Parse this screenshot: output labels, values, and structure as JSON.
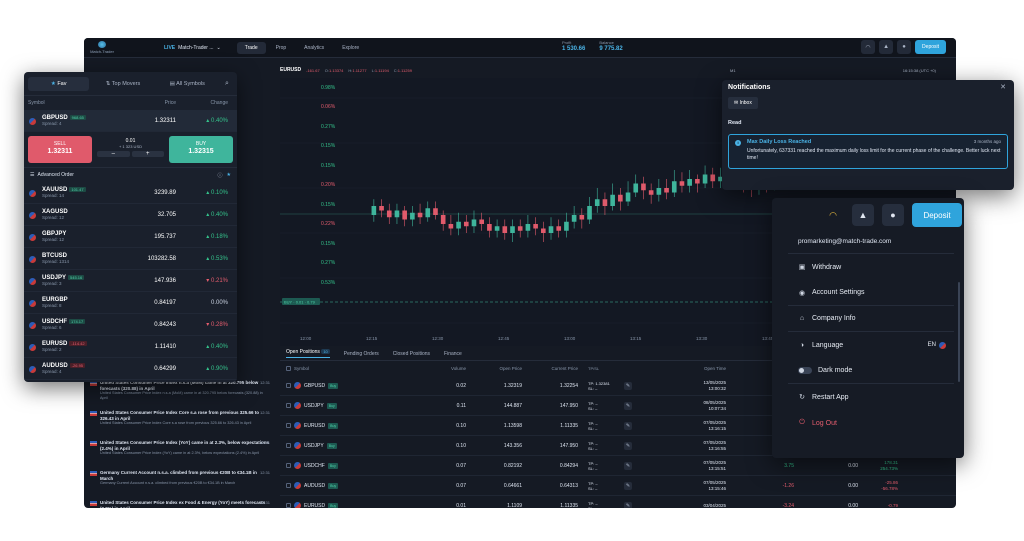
{
  "topbar": {
    "logo_text": "Match-Trader",
    "account_badge": "LIVE",
    "account_name": "Match-Trader ...",
    "tabs": [
      "Trade",
      "Prop",
      "Analytics",
      "Explore"
    ],
    "profit_label": "Profit",
    "profit_value": "1 530.66",
    "balance_label": "Balance",
    "balance_value": "9 775.82",
    "deposit_label": "Deposit"
  },
  "chart_header": {
    "symbol": "EURUSD",
    "change": "-161.67",
    "o_label": "O:",
    "o_value": "1.13374",
    "h_label": "H:",
    "h_value": "1.11277",
    "l_label": "L:",
    "l_value": "1.11194",
    "c_label": "C:",
    "c_value": "1.11259",
    "timeframe": "M1",
    "clock": "16:15:38 (UTC +0)"
  },
  "chart": {
    "x_ticks": [
      "12:00",
      "12:15",
      "12:30",
      "12:45",
      "13:00",
      "13:15",
      "13:30",
      "13:45",
      "14:00"
    ],
    "buy_tag": "BUY · 0.01 · 0.79",
    "reset_zoom": "Reset zoom",
    "candles": [
      [
        0.48,
        0.52,
        0.55,
        0.45
      ],
      [
        0.52,
        0.5,
        0.55,
        0.47
      ],
      [
        0.5,
        0.47,
        0.53,
        0.44
      ],
      [
        0.47,
        0.5,
        0.53,
        0.44
      ],
      [
        0.5,
        0.46,
        0.52,
        0.43
      ],
      [
        0.46,
        0.49,
        0.52,
        0.43
      ],
      [
        0.49,
        0.47,
        0.53,
        0.44
      ],
      [
        0.47,
        0.51,
        0.54,
        0.45
      ],
      [
        0.51,
        0.48,
        0.54,
        0.46
      ],
      [
        0.48,
        0.44,
        0.5,
        0.41
      ],
      [
        0.44,
        0.42,
        0.48,
        0.39
      ],
      [
        0.42,
        0.45,
        0.49,
        0.39
      ],
      [
        0.45,
        0.43,
        0.48,
        0.4
      ],
      [
        0.43,
        0.46,
        0.5,
        0.4
      ],
      [
        0.46,
        0.44,
        0.49,
        0.41
      ],
      [
        0.44,
        0.41,
        0.47,
        0.38
      ],
      [
        0.41,
        0.43,
        0.46,
        0.38
      ],
      [
        0.43,
        0.4,
        0.46,
        0.37
      ],
      [
        0.4,
        0.43,
        0.46,
        0.36
      ],
      [
        0.43,
        0.41,
        0.46,
        0.38
      ],
      [
        0.41,
        0.44,
        0.48,
        0.38
      ],
      [
        0.44,
        0.42,
        0.47,
        0.39
      ],
      [
        0.42,
        0.4,
        0.45,
        0.36
      ],
      [
        0.4,
        0.43,
        0.47,
        0.37
      ],
      [
        0.43,
        0.41,
        0.46,
        0.38
      ],
      [
        0.41,
        0.45,
        0.49,
        0.38
      ],
      [
        0.45,
        0.48,
        0.52,
        0.42
      ],
      [
        0.48,
        0.46,
        0.51,
        0.42
      ],
      [
        0.46,
        0.52,
        0.56,
        0.44
      ],
      [
        0.52,
        0.55,
        0.6,
        0.49
      ],
      [
        0.55,
        0.52,
        0.58,
        0.48
      ],
      [
        0.52,
        0.57,
        0.62,
        0.5
      ],
      [
        0.57,
        0.54,
        0.6,
        0.5
      ],
      [
        0.54,
        0.58,
        0.63,
        0.52
      ],
      [
        0.58,
        0.62,
        0.66,
        0.56
      ],
      [
        0.62,
        0.59,
        0.65,
        0.55
      ],
      [
        0.59,
        0.57,
        0.62,
        0.53
      ],
      [
        0.57,
        0.6,
        0.64,
        0.54
      ],
      [
        0.6,
        0.58,
        0.64,
        0.55
      ],
      [
        0.58,
        0.63,
        0.68,
        0.56
      ],
      [
        0.63,
        0.61,
        0.67,
        0.58
      ],
      [
        0.61,
        0.64,
        0.68,
        0.58
      ],
      [
        0.64,
        0.62,
        0.66,
        0.58
      ],
      [
        0.62,
        0.66,
        0.7,
        0.6
      ],
      [
        0.66,
        0.63,
        0.69,
        0.6
      ],
      [
        0.63,
        0.65,
        0.69,
        0.6
      ],
      [
        0.65,
        0.67,
        0.71,
        0.62
      ],
      [
        0.67,
        0.64,
        0.7,
        0.61
      ],
      [
        0.64,
        0.62,
        0.67,
        0.58
      ],
      [
        0.62,
        0.6,
        0.65,
        0.56
      ],
      [
        0.6,
        0.63,
        0.67,
        0.57
      ],
      [
        0.63,
        0.61,
        0.66,
        0.58
      ],
      [
        0.61,
        0.64,
        0.68,
        0.59
      ],
      [
        0.64,
        0.68,
        0.72,
        0.62
      ],
      [
        0.68,
        0.66,
        0.71,
        0.63
      ],
      [
        0.66,
        0.7,
        0.74,
        0.64
      ],
      [
        0.7,
        0.68,
        0.73,
        0.65
      ],
      [
        0.68,
        0.72,
        0.76,
        0.66
      ],
      [
        0.72,
        0.75,
        0.8,
        0.7
      ],
      [
        0.75,
        0.78,
        0.82,
        0.72
      ],
      [
        0.78,
        0.76,
        0.81,
        0.73
      ],
      [
        0.76,
        0.8,
        0.84,
        0.74
      ],
      [
        0.8,
        0.82,
        0.86,
        0.78
      ],
      [
        0.82,
        0.79,
        0.85,
        0.76
      ],
      [
        0.79,
        0.82,
        0.86,
        0.77
      ],
      [
        0.82,
        0.8,
        0.85,
        0.77
      ],
      [
        0.8,
        0.84,
        0.88,
        0.78
      ],
      [
        0.84,
        0.86,
        0.9,
        0.82
      ],
      [
        0.86,
        0.83,
        0.89,
        0.8
      ],
      [
        0.83,
        0.87,
        0.91,
        0.81
      ],
      [
        0.87,
        0.85,
        0.9,
        0.82
      ],
      [
        0.85,
        0.88,
        0.92,
        0.83
      ],
      [
        0.88,
        0.86,
        0.91,
        0.84
      ],
      [
        0.86,
        0.89,
        0.93,
        0.84
      ]
    ]
  },
  "positions": {
    "tabs": [
      {
        "label": "Open Positions",
        "count": "10"
      },
      {
        "label": "Pending Orders",
        "count": ""
      },
      {
        "label": "Closed Positions",
        "count": ""
      },
      {
        "label": "Finance",
        "count": ""
      }
    ],
    "columns": [
      "Symbol",
      "Volume",
      "Open Price",
      "Current Price",
      "TP/SL",
      "Open Time",
      "Swap",
      "Commission",
      "Net P/L"
    ],
    "rows": [
      {
        "symbol": "GBPUSD",
        "side": "Buy",
        "volume": "0.02",
        "open": "1.32319",
        "current": "1.32254",
        "tp": "TP: 1.32381",
        "sl": "SL: –",
        "date": "13/05/2025",
        "time": "13:00:32",
        "swap": "",
        "comm": "",
        "pnl": "",
        "pnl2": ""
      },
      {
        "symbol": "USDJPY",
        "side": "Buy",
        "volume": "0.11",
        "open": "144.887",
        "current": "147.950",
        "tp": "TP: –",
        "sl": "SL: –",
        "date": "08/05/2025",
        "time": "10:07:34",
        "swap": "",
        "comm": "",
        "pnl": "",
        "pnl2": ""
      },
      {
        "symbol": "EURUSD",
        "side": "Buy",
        "volume": "0.10",
        "open": "1.13598",
        "current": "1.11335",
        "tp": "TP: –",
        "sl": "SL: –",
        "date": "07/05/2025",
        "time": "13:16:15",
        "swap": "",
        "comm": "",
        "pnl": "",
        "pnl2": ""
      },
      {
        "symbol": "USDJPY",
        "side": "Buy",
        "volume": "0.10",
        "open": "143.356",
        "current": "147.950",
        "tp": "TP: –",
        "sl": "SL: –",
        "date": "07/05/2025",
        "time": "13:16:55",
        "swap": "",
        "comm": "",
        "pnl": "",
        "pnl2": ""
      },
      {
        "symbol": "USDCHF",
        "side": "Buy",
        "volume": "0.07",
        "open": "0.82192",
        "current": "0.84294",
        "tp": "TP: –",
        "sl": "SL: –",
        "date": "07/05/2025",
        "time": "13:15:51",
        "swap": "3.75",
        "comm": "0.00",
        "pnl": "178.31",
        "pnl2": "254.73%"
      },
      {
        "symbol": "AUDUSD",
        "side": "Buy",
        "volume": "0.07",
        "open": "0.64661",
        "current": "0.64313",
        "tp": "TP: –",
        "sl": "SL: –",
        "date": "07/05/2025",
        "time": "13:15:46",
        "swap": "-1.26",
        "comm": "0.00",
        "pnl": "-25.86",
        "pnl2": "-56.78%"
      },
      {
        "symbol": "EURUSD",
        "side": "Buy",
        "volume": "0.01",
        "open": "1.1109",
        "current": "1.11335",
        "tp": "TP: –",
        "sl": "SL: –",
        "date": "03/04/2025",
        "time": "",
        "swap": "-3.24",
        "comm": "0.00",
        "pnl": "-0.79",
        "pnl2": ""
      }
    ]
  },
  "bg_changes": [
    "0.98%",
    "0.06%",
    "0.27%",
    "0.15%",
    "0.15%",
    "0.20%",
    "0.15%",
    "0.22%",
    "0.15%",
    "0.27%",
    "0.53%"
  ],
  "news": [
    {
      "title": "United States Consumer Price Index n.s.a (MoM) came in at 320.795 below forecasts (320.88) in April",
      "sub": "United States Consumer Price Index n.s.a (MoM) came in at 320.795 below forecasts (320.88) in April",
      "time": "12:31"
    },
    {
      "title": "United States Consumer Price Index Core s.a rose from previous 325.66 to 326.43 in April",
      "sub": "United States Consumer Price Index Core s.a rose from previous 325.66 to 326.43 in April",
      "time": "12:31"
    },
    {
      "title": "United States Consumer Price Index (YoY) came in at 2.3%, below expectations (2.4%) in April",
      "sub": "United States Consumer Price Index (YoY) came in at 2.3%, below expectations (2.4%) in April",
      "time": "12:31"
    },
    {
      "title": "Germany Current Account n.s.a. climbed from previous €20B to €34.1B in March",
      "sub": "Germany Current Account n.s.a. climbed from previous €20B to €34.1B in March",
      "time": "12:31"
    },
    {
      "title": "United States Consumer Price Index ex Food & Energy (YoY) meets forecasts (2.8%) in April",
      "sub": "",
      "time": "12:31"
    }
  ],
  "watchlist": {
    "tabs": [
      "Fav",
      "Top Movers",
      "All Symbols"
    ],
    "col_symbol": "Symbol",
    "col_price": "Price",
    "col_change": "Change",
    "selected": {
      "symbol": "GBPUSD",
      "badge": "968.65",
      "spread": "Spread: 4",
      "price": "1.32311",
      "change": "0.40%"
    },
    "sell_label": "SELL",
    "sell_price": "1.32311",
    "buy_label": "BUY",
    "buy_price": "1.32315",
    "lot": "0.01",
    "units": "+ 1 323 USD",
    "minus": "–",
    "plus": "+",
    "advanced_order": "Advanced Order",
    "rows": [
      {
        "symbol": "XAUUSD",
        "badge": "101.47",
        "neg": false,
        "spread": "Spread: 14",
        "price": "3239.89",
        "change": "0.10%",
        "up": true
      },
      {
        "symbol": "XAGUSD",
        "badge": "",
        "neg": false,
        "spread": "Spread: 12",
        "price": "32.705",
        "change": "0.40%",
        "up": true
      },
      {
        "symbol": "GBPJPY",
        "badge": "",
        "neg": false,
        "spread": "Spread: 12",
        "price": "195.737",
        "change": "0.18%",
        "up": true
      },
      {
        "symbol": "BTCUSD",
        "badge": "",
        "neg": false,
        "spread": "Spread: 1314",
        "price": "103282.58",
        "change": "0.53%",
        "up": true
      },
      {
        "symbol": "USDJPY",
        "badge": "545.16",
        "neg": false,
        "spread": "Spread: 3",
        "price": "147.936",
        "change": "0.21%",
        "up": false
      },
      {
        "symbol": "EURGBP",
        "badge": "",
        "neg": false,
        "spread": "Spread: 8",
        "price": "0.84197",
        "change": "0.00%",
        "up": null
      },
      {
        "symbol": "USDCHF",
        "badge": "174.17",
        "neg": false,
        "spread": "Spread: 6",
        "price": "0.84243",
        "change": "0.28%",
        "up": false
      },
      {
        "symbol": "EURUSD",
        "badge": "-114.42",
        "neg": true,
        "spread": "Spread: 2",
        "price": "1.11410",
        "change": "0.40%",
        "up": true
      },
      {
        "symbol": "AUDUSD",
        "badge": "-26.95",
        "neg": true,
        "spread": "Spread: 4",
        "price": "0.64299",
        "change": "0.90%",
        "up": true
      }
    ]
  },
  "notifications": {
    "title": "Notifications",
    "tab": "Inbox",
    "section": "Read",
    "card_title": "Max Daily Loss Reached",
    "card_ago": "3 months ago",
    "card_body": "Unfortunately, 637331 reached the maximum daily loss limit for the current phase of the challenge. Better luck next time!"
  },
  "account_menu": {
    "deposit": "Deposit",
    "email": "promarketing@match-trade.com",
    "items": [
      "Withdraw",
      "Account Settings",
      "Company Info",
      "Language",
      "Dark mode",
      "Restart App",
      "Log Out"
    ],
    "language_value": "EN"
  }
}
